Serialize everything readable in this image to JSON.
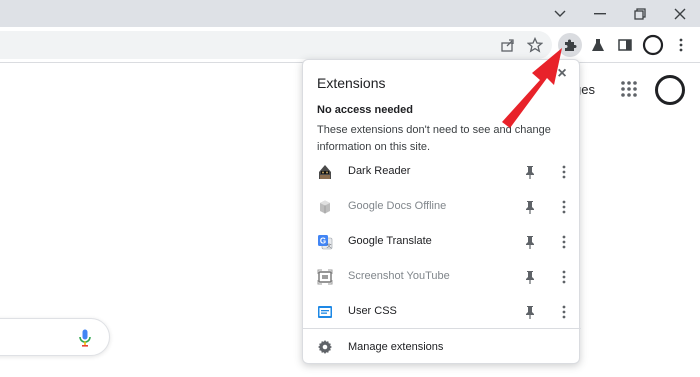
{
  "browser": {
    "title_controls": {
      "minimize": "chevron-down",
      "restore": "restore",
      "close": "×"
    }
  },
  "page": {
    "partial_text": "ges"
  },
  "extensions_popup": {
    "title": "Extensions",
    "close_label": "×",
    "section_heading": "No access needed",
    "section_description": "These extensions don't need to see and change information on this site.",
    "items": [
      {
        "name": "Dark Reader",
        "enabled": true,
        "icon": "dark-reader-icon"
      },
      {
        "name": "Google Docs Offline",
        "enabled": false,
        "icon": "docs-offline-icon"
      },
      {
        "name": "Google Translate",
        "enabled": true,
        "icon": "translate-icon"
      },
      {
        "name": "Screenshot YouTube",
        "enabled": false,
        "icon": "screenshot-icon"
      },
      {
        "name": "User CSS",
        "enabled": true,
        "icon": "css-icon"
      }
    ],
    "manage_label": "Manage extensions"
  },
  "colors": {
    "titlebar": "#dee1e6",
    "accent_red": "#e8222a",
    "google_blue": "#4285f4"
  }
}
